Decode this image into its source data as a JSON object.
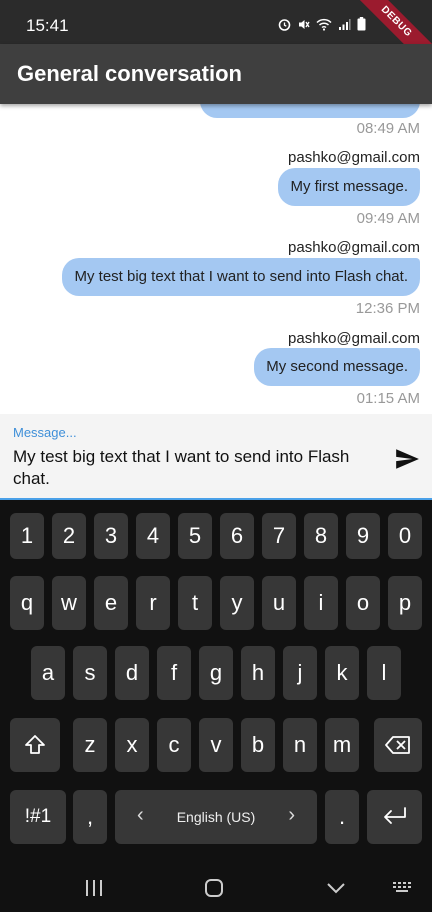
{
  "status": {
    "time": "15:41",
    "debug": "DEBUG"
  },
  "app": {
    "title": "General conversation"
  },
  "messages": [
    {
      "sender": "",
      "text": "",
      "time": "08:49 AM"
    },
    {
      "sender": "pashko@gmail.com",
      "text": "My first message.",
      "time": "09:49 AM"
    },
    {
      "sender": "pashko@gmail.com",
      "text": "My test big text that I want to send into Flash chat.",
      "time": "12:36 PM"
    },
    {
      "sender": "pashko@gmail.com",
      "text": "My second message.",
      "time": "01:15 AM"
    }
  ],
  "composer": {
    "label": "Message...",
    "value": "My test big text that I want to send into Flash chat."
  },
  "keyboard": {
    "row1": [
      "1",
      "2",
      "3",
      "4",
      "5",
      "6",
      "7",
      "8",
      "9",
      "0"
    ],
    "row2": [
      "q",
      "w",
      "e",
      "r",
      "t",
      "y",
      "u",
      "i",
      "o",
      "p"
    ],
    "row3": [
      "a",
      "s",
      "d",
      "f",
      "g",
      "h",
      "j",
      "k",
      "l"
    ],
    "row4": [
      "z",
      "x",
      "c",
      "v",
      "b",
      "n",
      "m"
    ],
    "symbols": "!#1",
    "comma": ",",
    "period": ".",
    "language": "English (US)",
    "lang_prev": "‹",
    "lang_next": "›"
  },
  "icons": {
    "send": "send-icon",
    "shift": "shift-icon",
    "backspace": "backspace-icon",
    "enter": "enter-icon"
  }
}
